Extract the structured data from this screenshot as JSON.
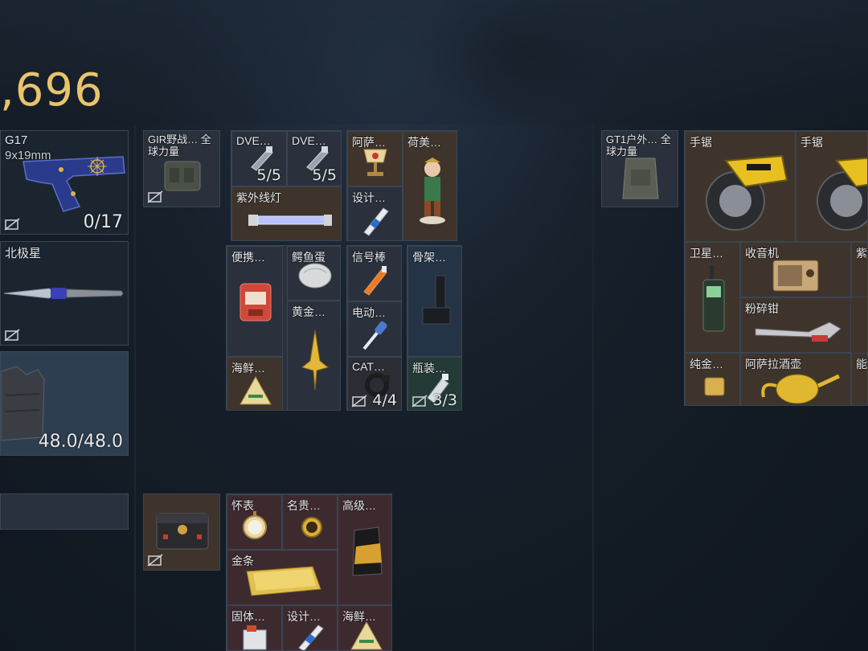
{
  "header": {
    "money": ",696"
  },
  "equipment": {
    "pistol": {
      "name": "G17",
      "caliber": "9x19mm",
      "ammo": "0/17"
    },
    "melee": {
      "name": "北极星"
    },
    "armor": {
      "durability": "48.0/48.0"
    }
  },
  "inventory": {
    "rig": {
      "label": "GIR野战… 全球力量"
    },
    "box1": [
      {
        "label": "DVE…",
        "count": "5/5"
      },
      {
        "label": "DVE…",
        "count": "5/5"
      },
      {
        "label": "紫外线灯"
      }
    ],
    "box2": [
      {
        "label": "阿萨…"
      },
      {
        "label": "荷美…"
      },
      {
        "label": "设计…"
      }
    ],
    "box3": [
      {
        "label": "便携…"
      },
      {
        "label": "鳄鱼蛋"
      },
      {
        "label": "黄金…"
      },
      {
        "label": "海鲜…"
      }
    ],
    "box4": [
      {
        "label": "信号棒"
      },
      {
        "label": "电动…"
      },
      {
        "label": "CAT…",
        "count": "4/4"
      }
    ],
    "box5": [
      {
        "label": "骨架…"
      },
      {
        "label": "瓶装…",
        "count": "3/3"
      }
    ],
    "case_items": [
      {
        "label": "怀表"
      },
      {
        "label": "名贵…"
      },
      {
        "label": "高级…"
      },
      {
        "label": "金条"
      },
      {
        "label": "固体…"
      },
      {
        "label": "设计…"
      },
      {
        "label": "海鲜…"
      }
    ]
  },
  "backpack": {
    "label": "GT1户外… 全球力量",
    "items": [
      {
        "label": "手锯"
      },
      {
        "label": "手锯"
      },
      {
        "label": "卫星…"
      },
      {
        "label": "收音机"
      },
      {
        "label": "紫"
      },
      {
        "label": "粉碎钳"
      },
      {
        "label": "纯金…"
      },
      {
        "label": "阿萨拉酒壶"
      },
      {
        "label": "能"
      }
    ]
  },
  "colors": {
    "money": "#e8c46a",
    "slot_border": "#3a4553",
    "background": "#121a23"
  }
}
